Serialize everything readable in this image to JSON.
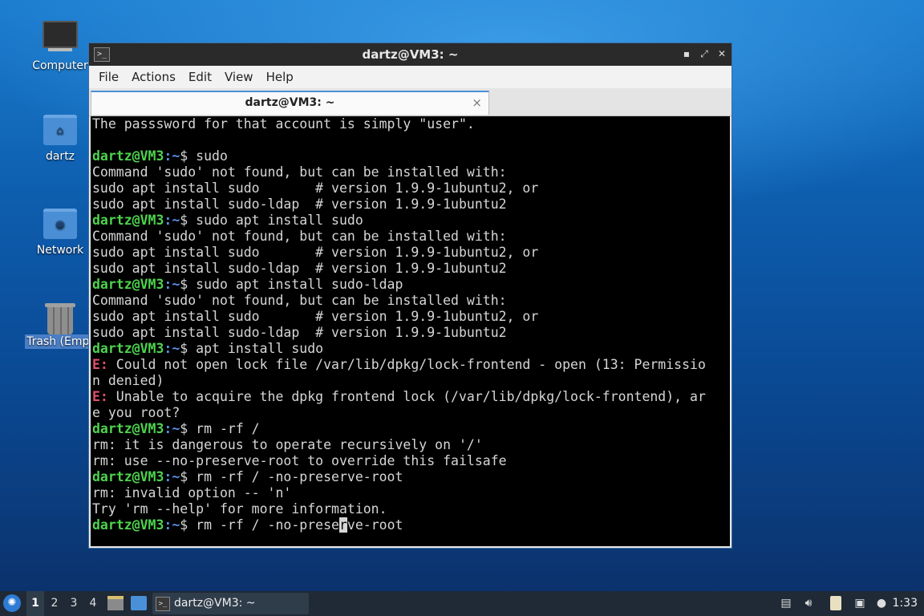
{
  "desktop": {
    "icons": [
      {
        "label": "Computer",
        "icon": "computer-icon"
      },
      {
        "label": "dartz",
        "icon": "home-folder-icon"
      },
      {
        "label": "Network",
        "icon": "network-folder-icon"
      },
      {
        "label": "Trash (Empt",
        "icon": "trash-icon"
      }
    ]
  },
  "window": {
    "title": "dartz@VM3: ~",
    "menu": [
      "File",
      "Actions",
      "Edit",
      "View",
      "Help"
    ],
    "tab_label": "dartz@VM3: ~",
    "tab_close": "×",
    "controls": {
      "minimize": "▪",
      "maximize": "⤢",
      "close": "✕"
    }
  },
  "terminal": {
    "lines": [
      {
        "text": "The passsword for that account is simply \"user\"."
      },
      {
        "text": ""
      },
      {
        "prompt": "dartz@VM3",
        "path": "~",
        "cmd": "$ sudo"
      },
      {
        "text": "Command 'sudo' not found, but can be installed with:"
      },
      {
        "text": "sudo apt install sudo       # version 1.9.9-1ubuntu2, or"
      },
      {
        "text": "sudo apt install sudo-ldap  # version 1.9.9-1ubuntu2"
      },
      {
        "prompt": "dartz@VM3",
        "path": "~",
        "cmd": "$ sudo apt install sudo"
      },
      {
        "text": "Command 'sudo' not found, but can be installed with:"
      },
      {
        "text": "sudo apt install sudo       # version 1.9.9-1ubuntu2, or"
      },
      {
        "text": "sudo apt install sudo-ldap  # version 1.9.9-1ubuntu2"
      },
      {
        "prompt": "dartz@VM3",
        "path": "~",
        "cmd": "$ sudo apt install sudo-ldap"
      },
      {
        "text": "Command 'sudo' not found, but can be installed with:"
      },
      {
        "text": "sudo apt install sudo       # version 1.9.9-1ubuntu2, or"
      },
      {
        "text": "sudo apt install sudo-ldap  # version 1.9.9-1ubuntu2"
      },
      {
        "prompt": "dartz@VM3",
        "path": "~",
        "cmd": "$ apt install sudo"
      },
      {
        "err": "E:",
        "text": " Could not open lock file /var/lib/dpkg/lock-frontend - open (13: Permissio"
      },
      {
        "text": "n denied)"
      },
      {
        "err": "E:",
        "text": " Unable to acquire the dpkg frontend lock (/var/lib/dpkg/lock-frontend), ar"
      },
      {
        "text": "e you root?"
      },
      {
        "prompt": "dartz@VM3",
        "path": "~",
        "cmd": "$ rm -rf /"
      },
      {
        "text": "rm: it is dangerous to operate recursively on '/'"
      },
      {
        "text": "rm: use --no-preserve-root to override this failsafe"
      },
      {
        "prompt": "dartz@VM3",
        "path": "~",
        "cmd": "$ rm -rf / -no-preserve-root"
      },
      {
        "text": "rm: invalid option -- 'n'"
      },
      {
        "text": "Try 'rm --help' for more information."
      },
      {
        "prompt": "dartz@VM3",
        "path": "~",
        "cmd": "$ rm -rf / -no-prese",
        "cursor_char": "r",
        "after": "ve-root"
      }
    ]
  },
  "taskbar": {
    "workspaces": [
      "1",
      "2",
      "3",
      "4"
    ],
    "active_workspace": "1",
    "task_label": "dartz@VM3: ~",
    "clock": "1:33"
  }
}
